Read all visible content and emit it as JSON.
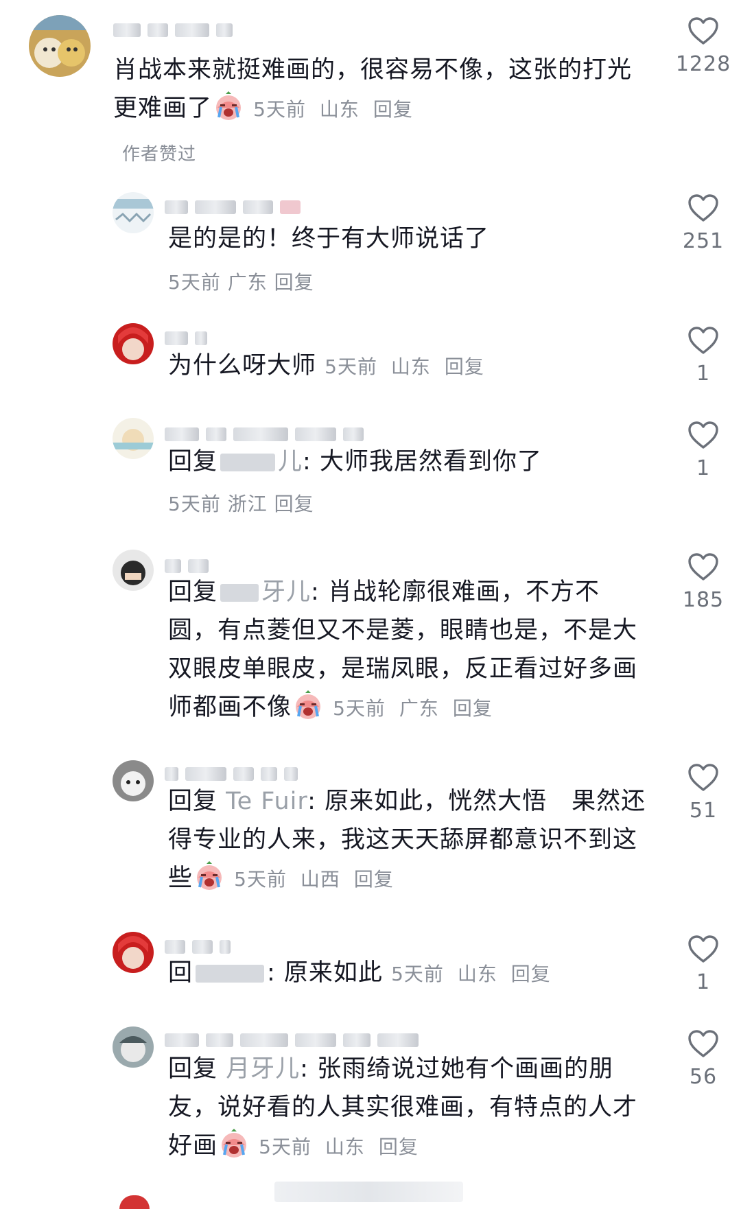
{
  "author_liked_label": "作者赞过",
  "reply_label": "回复",
  "comments": [
    {
      "text": "肖战本来就挺难画的，很容易不像，这张的打光更难画了",
      "time": "5天前",
      "location": "山东",
      "likes": "1228"
    },
    {
      "text": "是的是的！终于有大师说话了",
      "time": "5天前",
      "location": "广东",
      "likes": "251"
    },
    {
      "text": "为什么呀大师",
      "time": "5天前",
      "location": "山东",
      "likes": "1"
    },
    {
      "prefix": "回复",
      "target": "儿",
      "text": ": 大师我居然看到你了",
      "time": "5天前",
      "location": "浙江",
      "likes": "1"
    },
    {
      "prefix": "回复",
      "target": "牙儿",
      "text": ": 肖战轮廓很难画，不方不圆，有点菱但又不是菱，眼睛也是，不是大双眼皮单眼皮，是瑞凤眼，反正看过好多画师都画不像",
      "time": "5天前",
      "location": "广东",
      "likes": "185"
    },
    {
      "prefix": "回复",
      "target": "Te Fuir",
      "text": ": 原来如此，恍然大悟　果然还得专业的人来，我这天天舔屏都意识不到这些",
      "time": "5天前",
      "location": "山西",
      "likes": "51"
    },
    {
      "prefix": "回",
      "target": "",
      "text": ": 原来如此",
      "time": "5天前",
      "location": "山东",
      "likes": "1"
    },
    {
      "prefix": "回复",
      "target": "月牙儿",
      "text": ": 张雨绮说过她有个画画的朋友，说好看的人其实很难画，有特点的人才好画",
      "time": "5天前",
      "location": "山东",
      "likes": "56"
    }
  ],
  "colors": {
    "text": "#161823",
    "meta": "#8a8f98",
    "username": "#9aa0a8",
    "heart": "#6b7079"
  },
  "icons": {
    "like": "heart-outline-icon",
    "emoji": "crying-face-emoji"
  }
}
